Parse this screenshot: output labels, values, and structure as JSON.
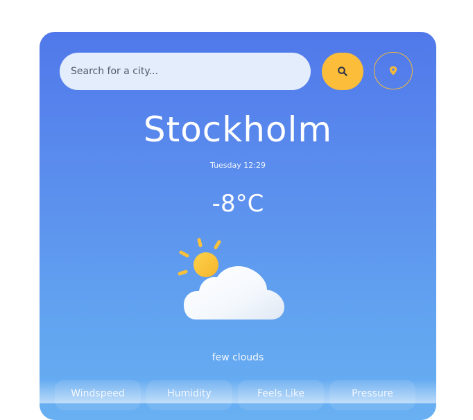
{
  "search": {
    "placeholder": "Search for a city..."
  },
  "icons": {
    "search": "search-icon",
    "location": "location-pin-icon",
    "weather": "sun-behind-cloud-icon"
  },
  "colors": {
    "card_gradient_top": "#5078ea",
    "card_gradient_bottom": "#68b0f2",
    "accent": "#fbbd3a",
    "search_field": "#e3edfb"
  },
  "weather": {
    "city": "Stockholm",
    "datetime": "Tuesday 12:29",
    "temperature": "-8°C",
    "description": "few clouds"
  },
  "stats": {
    "windspeed_label": "Windspeed",
    "humidity_label": "Humidity",
    "feels_like_label": "Feels Like",
    "pressure_label": "Pressure"
  }
}
